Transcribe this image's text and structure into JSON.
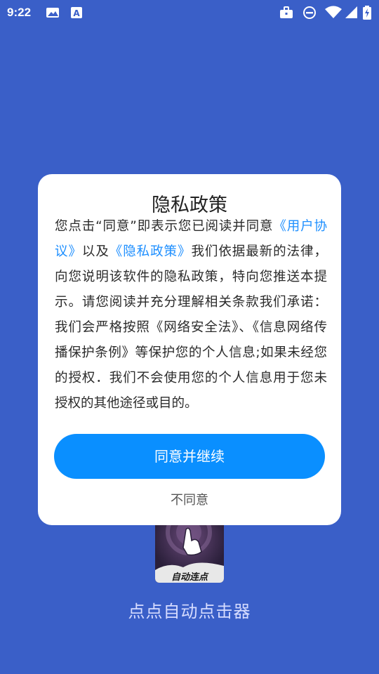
{
  "status_bar": {
    "time": "9:22",
    "left_icons": [
      "image-icon",
      "text-a-icon"
    ],
    "right_icons": [
      "briefcase-icon",
      "do-not-disturb-icon",
      "wifi-icon",
      "signal-icon",
      "battery-charging-icon"
    ]
  },
  "app": {
    "icon_label": "自动连点",
    "name": "点点自动点击器"
  },
  "dialog": {
    "title": "隐私政策",
    "body": {
      "part1": "您点击“同意”即表示您已阅读并同意",
      "link1": "《用户协议》",
      "part2": "以及",
      "link2": "《隐私政策》",
      "part3": "我们依据最新的法律，向您说明该软件的隐私政策，特向您推送本提示。请您阅读并充分理解相关条款我们承诺：我们会严格按照《网络安全法》、《信息网络传播保护条例》等保护您的个人信息;如果未经您的授权．我们不会使用您的个人信息用于您未授权的其他途径或目的。"
    },
    "agree_label": "同意并继续",
    "disagree_label": "不同意"
  },
  "colors": {
    "background": "#3a5fc8",
    "accent": "#0a8fff",
    "link": "#1e8fff"
  }
}
